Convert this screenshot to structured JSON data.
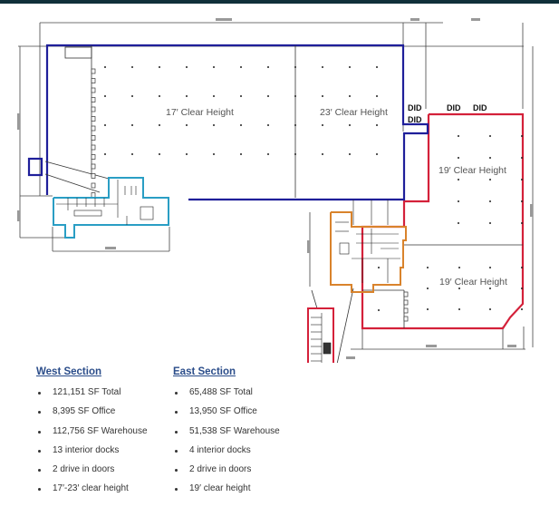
{
  "colors": {
    "west_warehouse": "#1f1f9a",
    "west_office": "#2a9ec4",
    "east_warehouse": "#d4213a",
    "east_office": "#d9832c",
    "heading": "#2b4d8a",
    "topbar": "#10303a"
  },
  "plan": {
    "areas": [
      {
        "name": "west-17",
        "label": "17′ Clear Height"
      },
      {
        "name": "west-23",
        "label": "23′ Clear Height"
      },
      {
        "name": "east-upper",
        "label": "19′ Clear Height"
      },
      {
        "name": "east-lower",
        "label": "19′ Clear Height"
      }
    ],
    "doors": [
      "DID",
      "DID",
      "DID",
      "DID"
    ]
  },
  "legend": {
    "west": {
      "title": "West Section",
      "items": [
        "121,151 SF Total",
        "8,395 SF Office",
        "112,756 SF Warehouse",
        "13 interior docks",
        "2 drive in doors",
        "17′-23′ clear height"
      ]
    },
    "east": {
      "title": "East Section",
      "items": [
        "65,488 SF Total",
        "13,950 SF Office",
        "51,538 SF Warehouse",
        "4 interior docks",
        "2 drive in doors",
        "19′ clear height"
      ]
    }
  }
}
